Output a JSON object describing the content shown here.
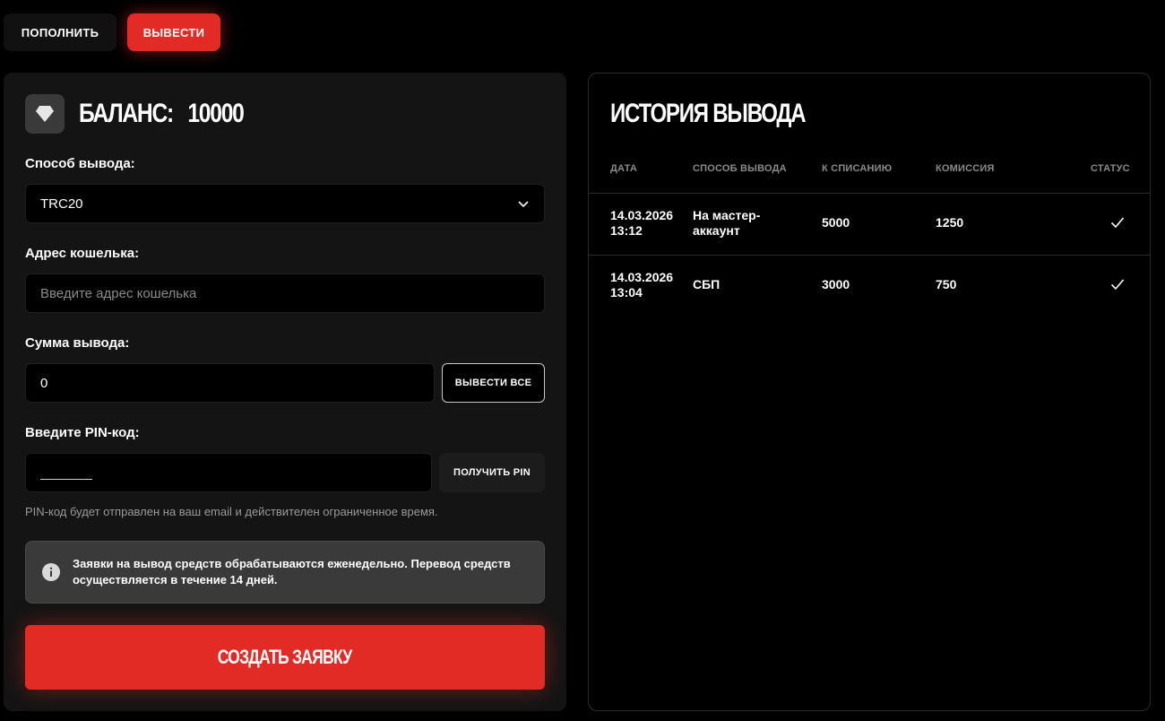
{
  "tabs": {
    "deposit": "ПОПОЛНИТЬ",
    "withdraw": "ВЫВЕСТИ"
  },
  "balance": {
    "label": "БАЛАНС:",
    "value": "10000"
  },
  "form": {
    "method_label": "Способ вывода:",
    "method_value": "TRC20",
    "wallet_label": "Адрес кошелька:",
    "wallet_placeholder": "Введите адрес кошелька",
    "amount_label": "Сумма вывода:",
    "amount_value": "0",
    "withdraw_all": "ВЫВЕСТИ ВСЕ",
    "pin_label": "Введите PIN-код:",
    "get_pin": "ПОЛУЧИТЬ PIN",
    "pin_hint": "PIN-код будет отправлен на ваш email и действителен ограниченное время.",
    "notice": "Заявки на вывод средств обрабатываются еженедельно. Перевод средств осуществляется в течение 14 дней.",
    "submit": "СОЗДАТЬ ЗАЯВКУ"
  },
  "history": {
    "title": "ИСТОРИЯ ВЫВОДА",
    "columns": [
      "ДАТА",
      "СПОСОБ ВЫВОДА",
      "К СПИСАНИЮ",
      "КОМИССИЯ",
      "СТАТУС"
    ],
    "rows": [
      {
        "date": "14.03.2026",
        "time": "13:12",
        "method_line1": "На мастер-",
        "method_line2": "аккаунт",
        "amount": "5000",
        "fee": "1250",
        "status": "check-icon"
      },
      {
        "date": "14.03.2026",
        "time": "13:04",
        "method_line1": "СБП",
        "method_line2": "",
        "amount": "3000",
        "fee": "750",
        "status": "check-icon"
      }
    ]
  },
  "colors": {
    "accent": "#e32b26",
    "panel": "#141414",
    "background": "#000000"
  }
}
